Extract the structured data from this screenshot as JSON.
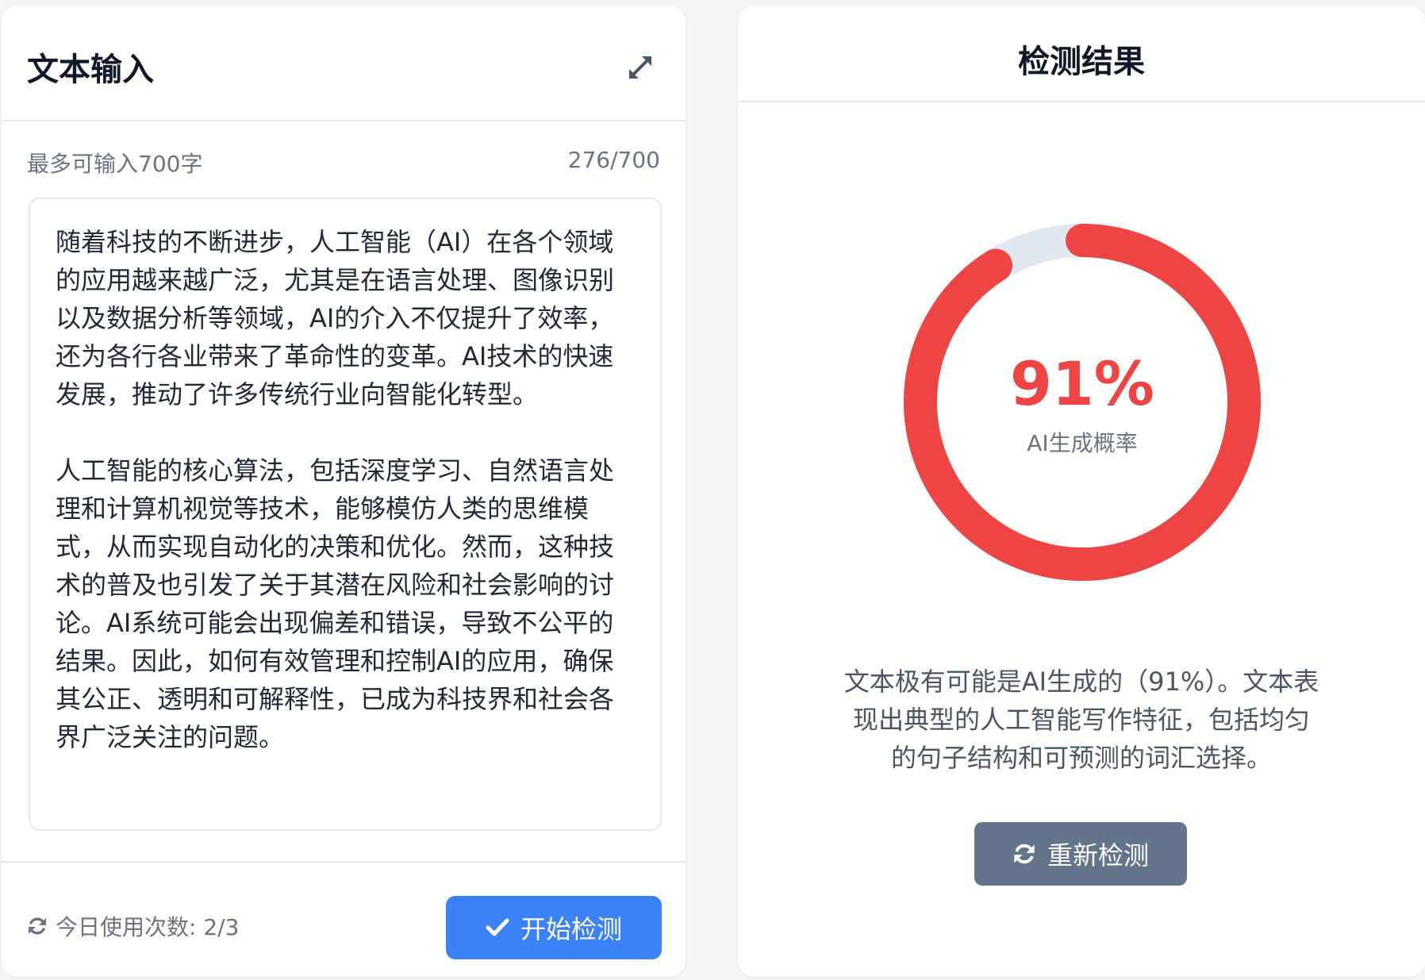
{
  "input_panel": {
    "title": "文本输入",
    "expand_icon": "expand-icon",
    "limit_text": "最多可输入700字",
    "char_count": "276/700",
    "text_value": "随着科技的不断进步，人工智能（AI）在各个领域的应用越来越广泛，尤其是在语言处理、图像识别以及数据分析等领域，AI的介入不仅提升了效率，还为各行各业带来了革命性的变革。AI技术的快速发展，推动了许多传统行业向智能化转型。\n\n人工智能的核心算法，包括深度学习、自然语言处理和计算机视觉等技术，能够模仿人类的思维模式，从而实现自动化的决策和优化。然而，这种技术的普及也引发了关于其潜在风险和社会影响的讨论。AI系统可能会出现偏差和错误，导致不公平的结果。因此，如何有效管理和控制AI的应用，确保其公正、透明和可解释性，已成为科技界和社会各界广泛关注的问题。",
    "usage_icon": "refresh-icon",
    "usage_text": "今日使用次数: 2/3",
    "start_icon": "check-icon",
    "start_label": "开始检测"
  },
  "result_panel": {
    "title": "检测结果",
    "probability_fraction": 0.91,
    "percent_text": "91%",
    "percent_label": "AI生成概率",
    "description": "文本极有可能是AI生成的（91%）。文本表现出典型的人工智能写作特征，包括均匀的句子结构和可预测的词汇选择。",
    "retest_icon": "refresh-icon",
    "retest_label": "重新检测"
  },
  "colors": {
    "primary": "#3b82f6",
    "danger": "#ef4444",
    "ring_track": "#e2e8f0",
    "secondary_button": "#64748b"
  }
}
